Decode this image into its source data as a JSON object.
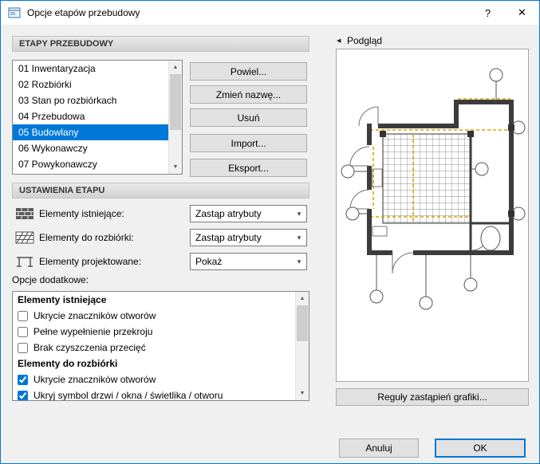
{
  "window": {
    "title": "Opcje etapów przebudowy"
  },
  "titlebar": {
    "help_label": "?",
    "close_label": "✕"
  },
  "phases_section": {
    "header": "ETAPY PRZEBUDOWY"
  },
  "phases": {
    "items": [
      {
        "label": "01 Inwentaryzacja",
        "selected": false
      },
      {
        "label": "02 Rozbiórki",
        "selected": false
      },
      {
        "label": "03 Stan po rozbiórkach",
        "selected": false
      },
      {
        "label": "04 Przebudowa",
        "selected": false
      },
      {
        "label": "05 Budowlany",
        "selected": true
      },
      {
        "label": "06 Wykonawczy",
        "selected": false
      },
      {
        "label": "07 Powykonawczy",
        "selected": false
      }
    ]
  },
  "phase_buttons": {
    "duplicate": "Powiel...",
    "rename": "Zmień nazwę...",
    "remove": "Usuń",
    "import": "Import...",
    "export": "Eksport..."
  },
  "settings_section": {
    "header": "USTAWIENIA ETAPU"
  },
  "settings": {
    "rows": [
      {
        "label": "Elementy istniejące:",
        "value": "Zastąp atrybuty"
      },
      {
        "label": "Elementy do rozbiórki:",
        "value": "Zastąp atrybuty"
      },
      {
        "label": "Elementy projektowane:",
        "value": "Pokaż"
      }
    ],
    "extra_options_label": "Opcje dodatkowe:"
  },
  "options": {
    "groups": [
      {
        "header": "Elementy istniejące",
        "items": [
          {
            "label": "Ukrycie znaczników otworów",
            "checked": false
          },
          {
            "label": "Pełne wypełnienie przekroju",
            "checked": false
          },
          {
            "label": "Brak czyszczenia przecięć",
            "checked": false
          }
        ]
      },
      {
        "header": "Elementy do rozbiórki",
        "items": [
          {
            "label": "Ukrycie znaczników otworów",
            "checked": true
          },
          {
            "label": "Ukryj symbol drzwi / okna / świetlika / otworu",
            "checked": true
          }
        ]
      }
    ]
  },
  "preview": {
    "label": "Podgląd",
    "rules_button": "Reguły zastąpień grafiki..."
  },
  "footer": {
    "cancel": "Anuluj",
    "ok": "OK"
  },
  "glyphs": {
    "combo_arrow": "▾",
    "scroll_up": "▲",
    "scroll_down": "▼",
    "collapse_left": "◀"
  },
  "colors": {
    "accent": "#0078d7",
    "selection": "#0078d7",
    "demolition_highlight": "#dfa300"
  }
}
